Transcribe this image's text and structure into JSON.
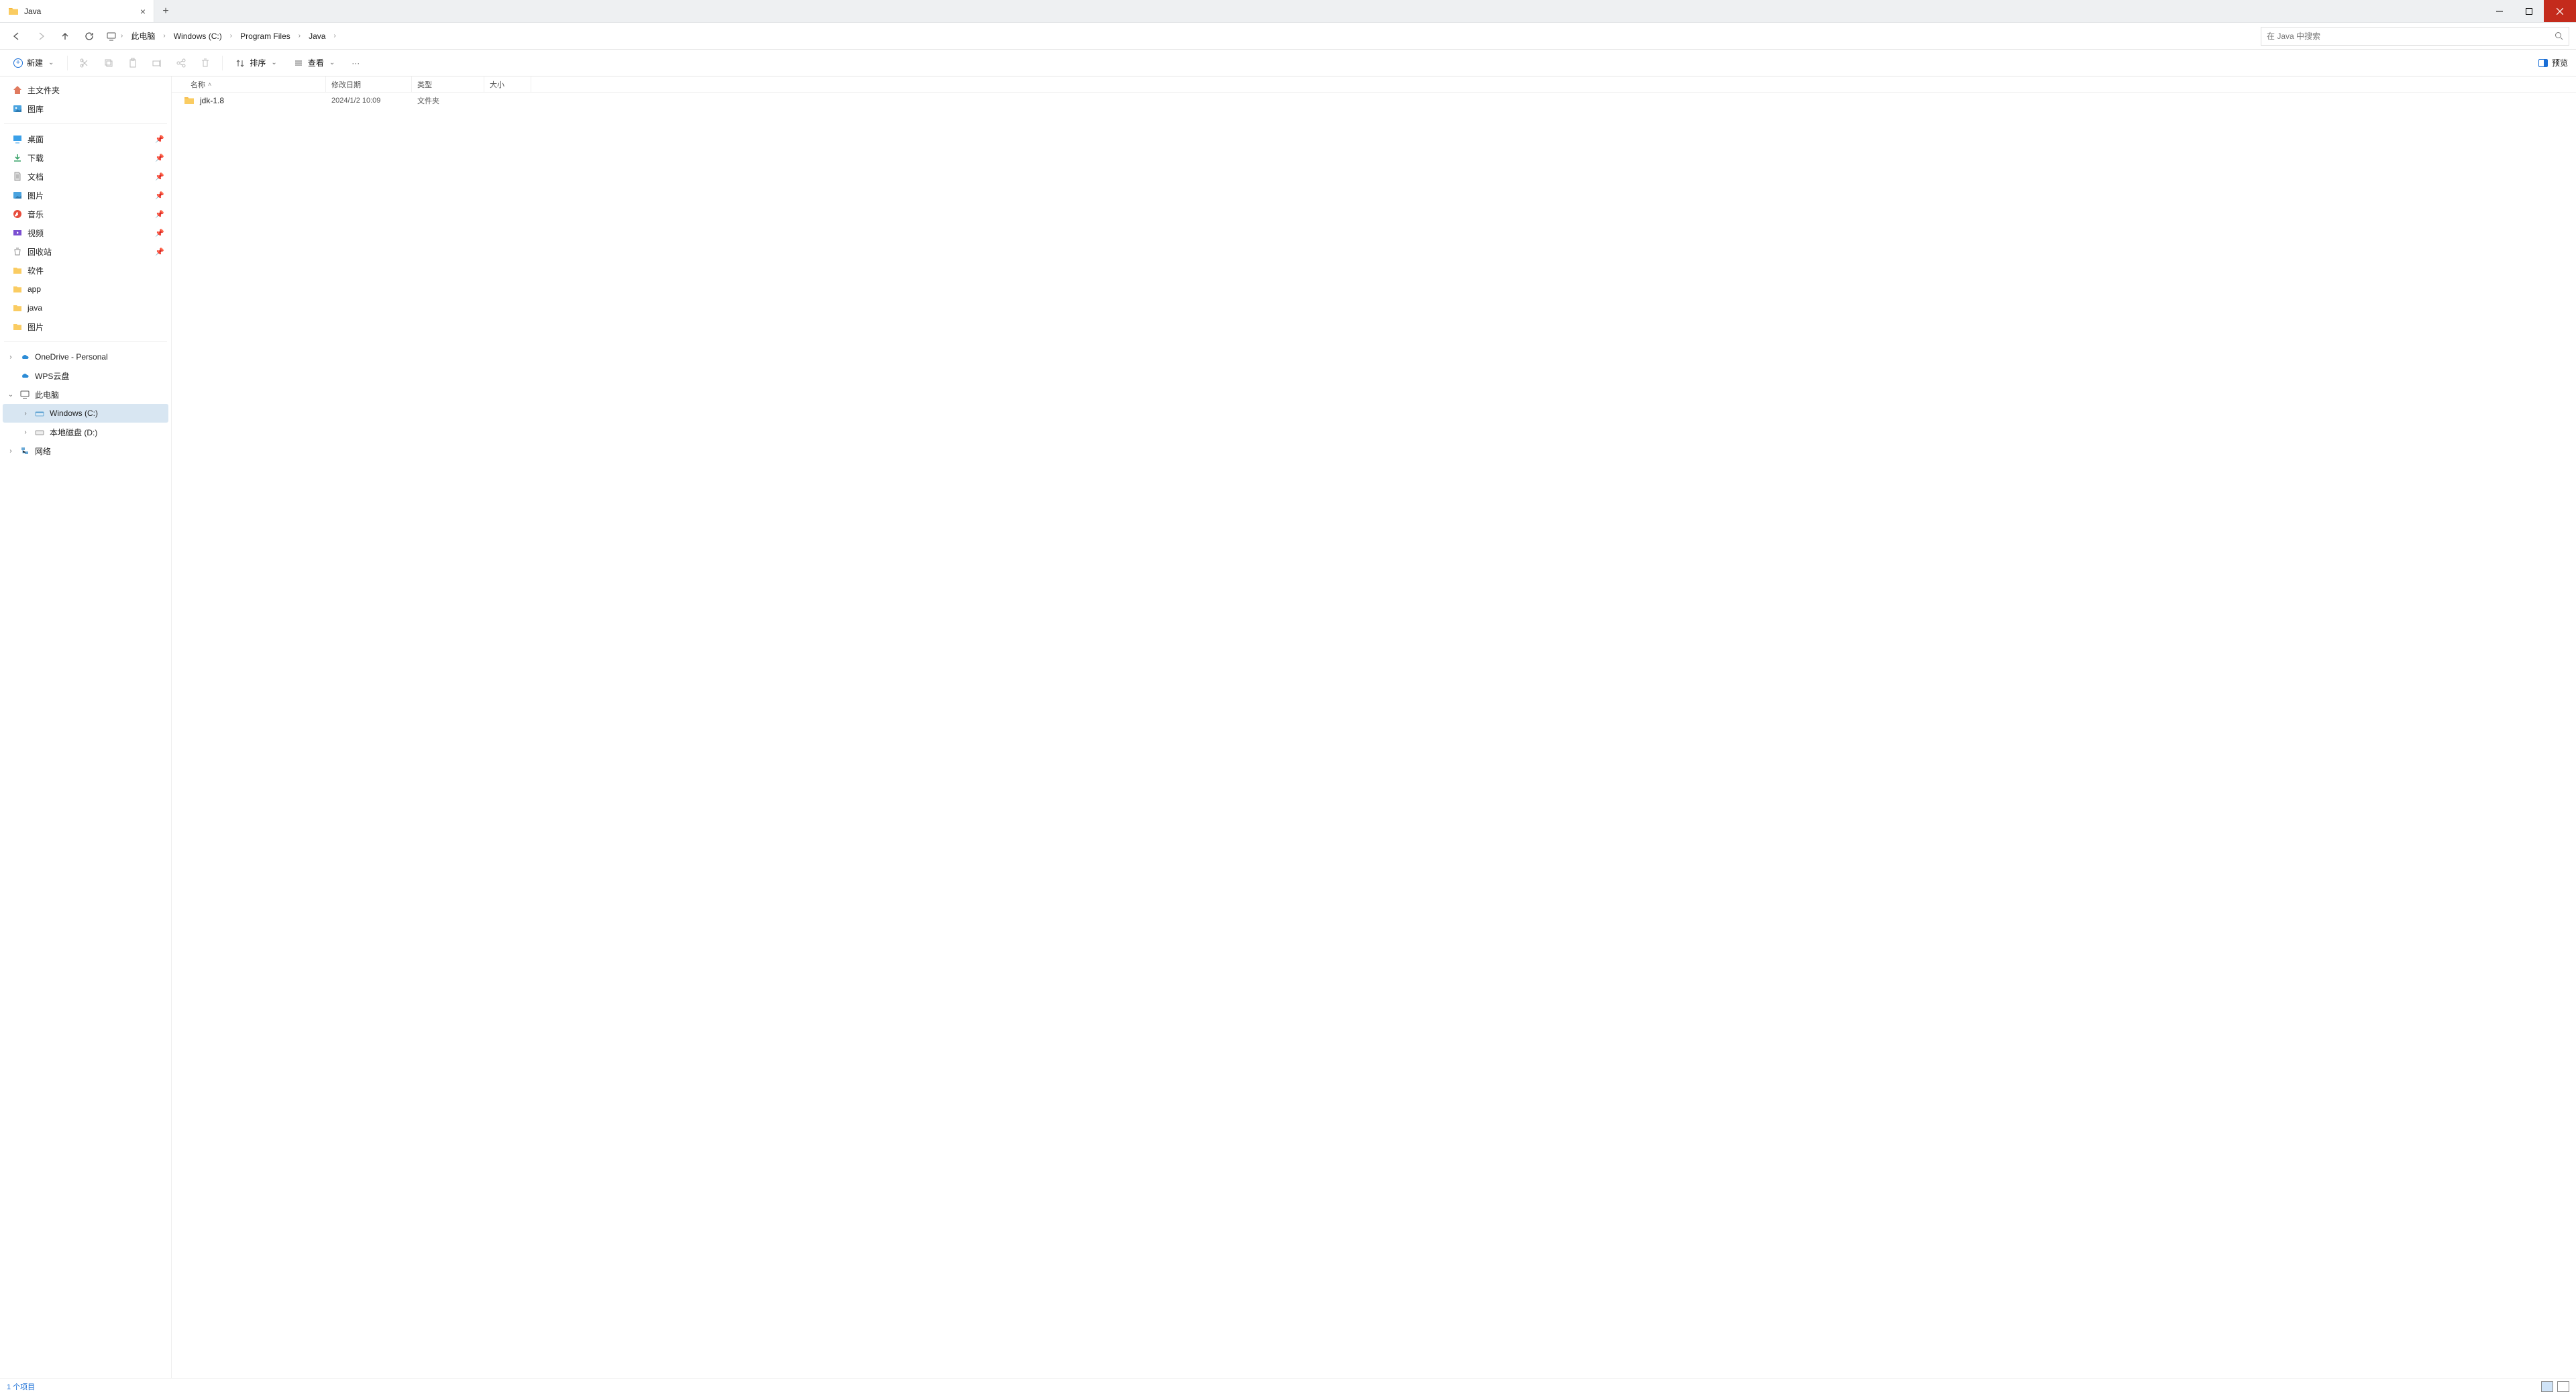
{
  "tab": {
    "title": "Java"
  },
  "breadcrumbs": [
    "此电脑",
    "Windows (C:)",
    "Program Files",
    "Java"
  ],
  "search": {
    "placeholder": "在 Java 中搜索"
  },
  "toolbar": {
    "new_label": "新建",
    "sort_label": "排序",
    "view_label": "查看",
    "preview_label": "预览"
  },
  "sidebar": {
    "home": "主文件夹",
    "gallery": "图库",
    "quick": [
      {
        "label": "桌面"
      },
      {
        "label": "下载"
      },
      {
        "label": "文档"
      },
      {
        "label": "图片"
      },
      {
        "label": "音乐"
      },
      {
        "label": "视频"
      },
      {
        "label": "回收站"
      },
      {
        "label": "软件"
      },
      {
        "label": "app"
      },
      {
        "label": "java"
      },
      {
        "label": "图片"
      }
    ],
    "onedrive": "OneDrive - Personal",
    "wps": "WPS云盘",
    "thispc": "此电脑",
    "drive_c": "Windows (C:)",
    "drive_d": "本地磁盘 (D:)",
    "network": "网络"
  },
  "columns": {
    "name": "名称",
    "date": "修改日期",
    "type": "类型",
    "size": "大小"
  },
  "rows": [
    {
      "name": "jdk-1.8",
      "date": "2024/1/2 10:09",
      "type": "文件夹",
      "size": ""
    }
  ],
  "status": {
    "text": "1 个项目"
  }
}
